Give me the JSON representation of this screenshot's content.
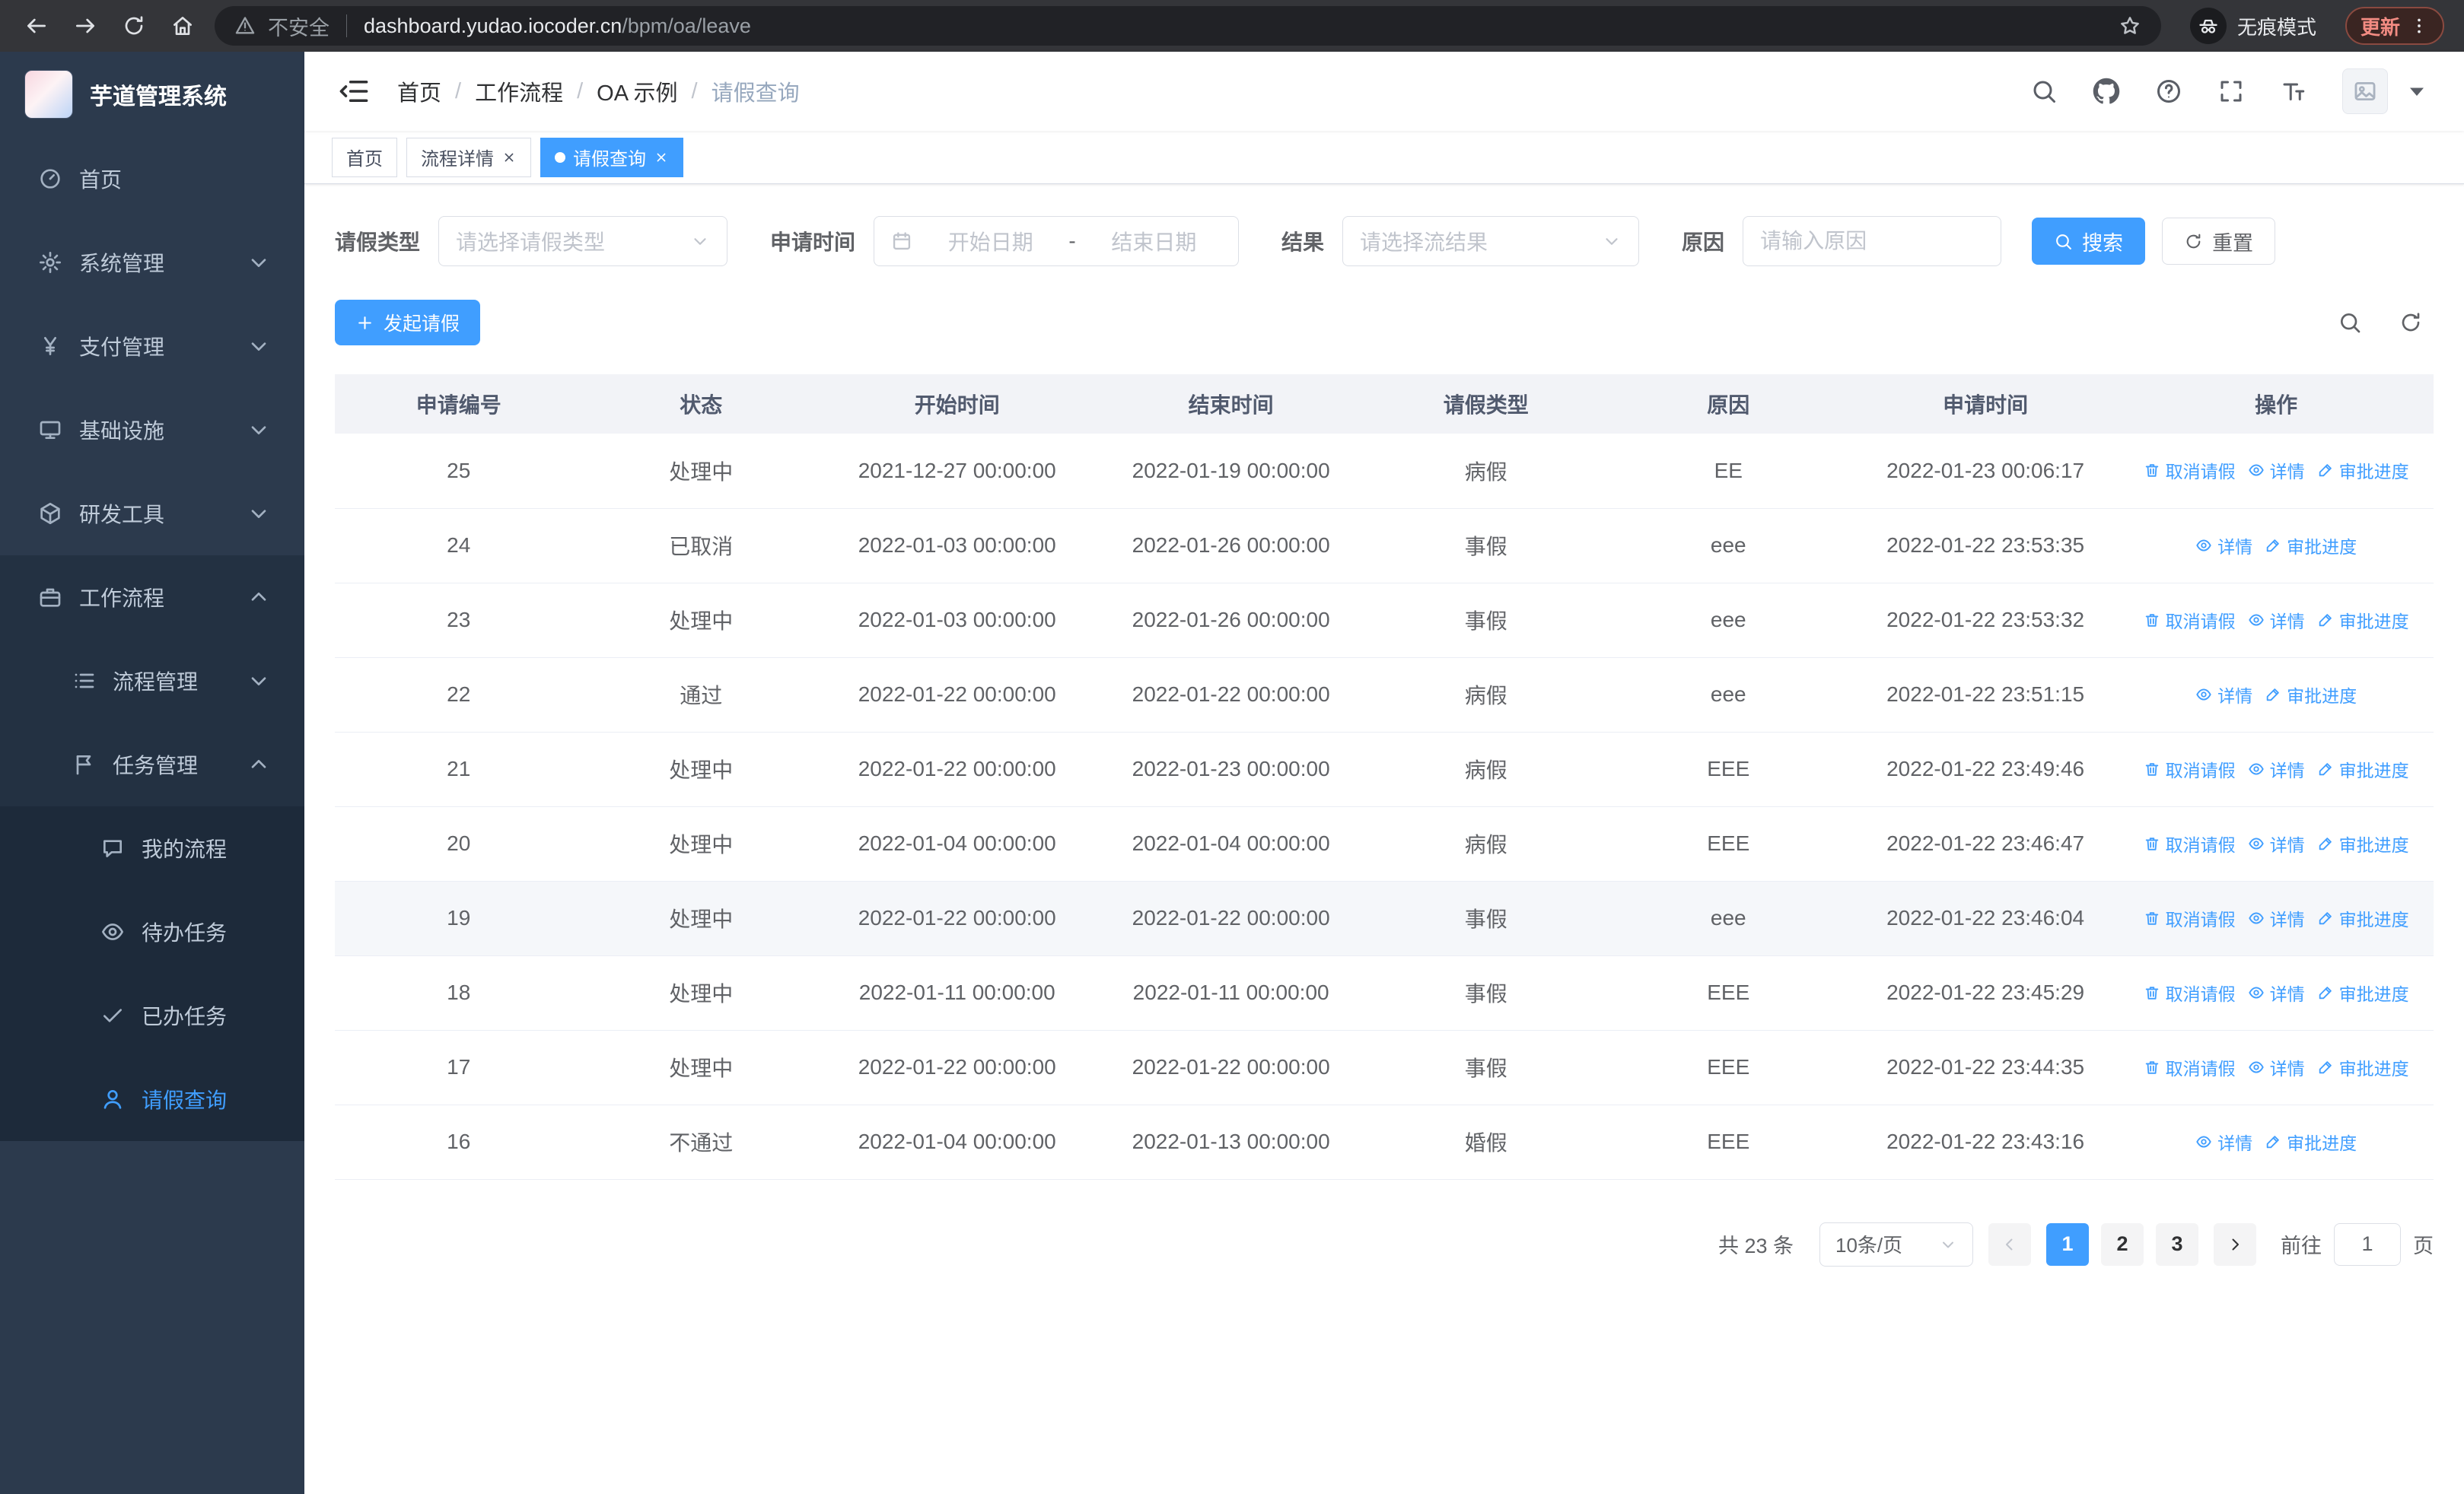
{
  "colors": {
    "accent": "#409eff"
  },
  "browser": {
    "security_label": "不安全",
    "url_domain": "dashboard.yudao.iocoder.cn",
    "url_path": "/bpm/oa/leave",
    "incognito_label": "无痕模式",
    "update_label": "更新"
  },
  "sidebar": {
    "app_title": "芋道管理系统",
    "items": [
      {
        "key": "home",
        "label": "首页",
        "icon": "dashboard-icon",
        "level": 1
      },
      {
        "key": "system",
        "label": "系统管理",
        "icon": "gear-icon",
        "level": 1,
        "chevron": "down"
      },
      {
        "key": "payment",
        "label": "支付管理",
        "icon": "yen-icon",
        "level": 1,
        "chevron": "down"
      },
      {
        "key": "infrastructure",
        "label": "基础设施",
        "icon": "monitor-icon",
        "level": 1,
        "chevron": "down"
      },
      {
        "key": "dev-tools",
        "label": "研发工具",
        "icon": "toolbox-icon",
        "level": 1,
        "chevron": "down"
      },
      {
        "key": "workflow",
        "label": "工作流程",
        "icon": "briefcase-icon",
        "level": 1,
        "chevron": "up",
        "open": true
      },
      {
        "key": "process-management",
        "label": "流程管理",
        "icon": "list-icon",
        "level": 2,
        "chevron": "down"
      },
      {
        "key": "task-management",
        "label": "任务管理",
        "icon": "flag-icon",
        "level": 2,
        "chevron": "up"
      },
      {
        "key": "my-process",
        "label": "我的流程",
        "icon": "chat-icon",
        "level": 3
      },
      {
        "key": "todo-task",
        "label": "待办任务",
        "icon": "eye-icon",
        "level": 3
      },
      {
        "key": "done-task",
        "label": "已办任务",
        "icon": "check-icon",
        "level": 3
      },
      {
        "key": "leave-query",
        "label": "请假查询",
        "icon": "user-icon",
        "level": 3,
        "active": true
      }
    ]
  },
  "header": {
    "breadcrumb": [
      "首页",
      "工作流程",
      "OA 示例",
      "请假查询"
    ]
  },
  "tabs": [
    {
      "key": "home",
      "label": "首页",
      "closable": false,
      "active": false
    },
    {
      "key": "process-detail",
      "label": "流程详情",
      "closable": true,
      "active": false
    },
    {
      "key": "leave-query",
      "label": "请假查询",
      "closable": true,
      "active": true
    }
  ],
  "filters": {
    "leave_type_label": "请假类型",
    "leave_type_placeholder": "请选择请假类型",
    "apply_time_label": "申请时间",
    "date_start_placeholder": "开始日期",
    "date_separator": "-",
    "date_end_placeholder": "结束日期",
    "result_label": "结果",
    "result_placeholder": "请选择流结果",
    "reason_label": "原因",
    "reason_placeholder": "请输入原因",
    "search_label": "搜索",
    "reset_label": "重置"
  },
  "toolbar": {
    "create_label": "发起请假"
  },
  "table": {
    "columns": [
      "申请编号",
      "状态",
      "开始时间",
      "结束时间",
      "请假类型",
      "原因",
      "申请时间",
      "操作"
    ],
    "action_labels": {
      "cancel": "取消请假",
      "detail": "详情",
      "progress": "审批进度"
    },
    "rows": [
      {
        "id": "25",
        "status": "处理中",
        "start": "2021-12-27 00:00:00",
        "end": "2022-01-19 00:00:00",
        "type": "病假",
        "reason": "EE",
        "apply_time": "2022-01-23 00:06:17",
        "actions": [
          "cancel",
          "detail",
          "progress"
        ]
      },
      {
        "id": "24",
        "status": "已取消",
        "start": "2022-01-03 00:00:00",
        "end": "2022-01-26 00:00:00",
        "type": "事假",
        "reason": "eee",
        "apply_time": "2022-01-22 23:53:35",
        "actions": [
          "detail",
          "progress"
        ]
      },
      {
        "id": "23",
        "status": "处理中",
        "start": "2022-01-03 00:00:00",
        "end": "2022-01-26 00:00:00",
        "type": "事假",
        "reason": "eee",
        "apply_time": "2022-01-22 23:53:32",
        "actions": [
          "cancel",
          "detail",
          "progress"
        ]
      },
      {
        "id": "22",
        "status": "通过",
        "start": "2022-01-22 00:00:00",
        "end": "2022-01-22 00:00:00",
        "type": "病假",
        "reason": "eee",
        "apply_time": "2022-01-22 23:51:15",
        "actions": [
          "detail",
          "progress"
        ]
      },
      {
        "id": "21",
        "status": "处理中",
        "start": "2022-01-22 00:00:00",
        "end": "2022-01-23 00:00:00",
        "type": "病假",
        "reason": "EEE",
        "apply_time": "2022-01-22 23:49:46",
        "actions": [
          "cancel",
          "detail",
          "progress"
        ]
      },
      {
        "id": "20",
        "status": "处理中",
        "start": "2022-01-04 00:00:00",
        "end": "2022-01-04 00:00:00",
        "type": "病假",
        "reason": "EEE",
        "apply_time": "2022-01-22 23:46:47",
        "actions": [
          "cancel",
          "detail",
          "progress"
        ]
      },
      {
        "id": "19",
        "status": "处理中",
        "start": "2022-01-22 00:00:00",
        "end": "2022-01-22 00:00:00",
        "type": "事假",
        "reason": "eee",
        "apply_time": "2022-01-22 23:46:04",
        "actions": [
          "cancel",
          "detail",
          "progress"
        ]
      },
      {
        "id": "18",
        "status": "处理中",
        "start": "2022-01-11 00:00:00",
        "end": "2022-01-11 00:00:00",
        "type": "事假",
        "reason": "EEE",
        "apply_time": "2022-01-22 23:45:29",
        "actions": [
          "cancel",
          "detail",
          "progress"
        ]
      },
      {
        "id": "17",
        "status": "处理中",
        "start": "2022-01-22 00:00:00",
        "end": "2022-01-22 00:00:00",
        "type": "事假",
        "reason": "EEE",
        "apply_time": "2022-01-22 23:44:35",
        "actions": [
          "cancel",
          "detail",
          "progress"
        ]
      },
      {
        "id": "16",
        "status": "不通过",
        "start": "2022-01-04 00:00:00",
        "end": "2022-01-13 00:00:00",
        "type": "婚假",
        "reason": "EEE",
        "apply_time": "2022-01-22 23:43:16",
        "actions": [
          "detail",
          "progress"
        ]
      }
    ]
  },
  "pagination": {
    "total_label": "共 23 条",
    "page_size": "10条/页",
    "pages": [
      "1",
      "2",
      "3"
    ],
    "active_page": "1",
    "goto_label": "前往",
    "goto_value": "1",
    "page_unit": "页"
  }
}
